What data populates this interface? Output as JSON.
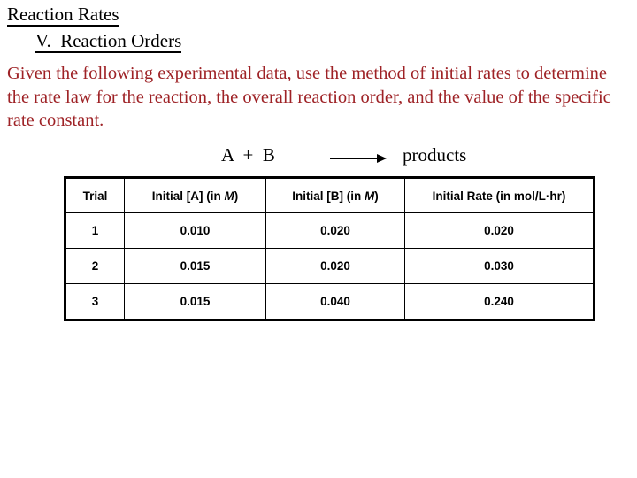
{
  "slide": {
    "title": "Reaction Rates",
    "subtitle": "V.  Reaction Orders",
    "body": "Given the following experimental data, use the method of initial rates to determine the rate law for the reaction, the overall reaction order, and the value of the specific rate constant.",
    "equation": {
      "reactants": "A  +  B",
      "arrow_icon": "right-arrow-icon",
      "products": "products"
    },
    "colors": {
      "body_text": "#9E2226",
      "title_text": "#000000",
      "table_border": "#000000",
      "background": "#FFFFFF"
    }
  },
  "table": {
    "headers": {
      "trial": "Trial",
      "a_prefix": "Initial [A] (in ",
      "a_unit": "M",
      "a_suffix": ")",
      "b_prefix": "Initial [B] (in ",
      "b_unit": "M",
      "b_suffix": ")",
      "rate": "Initial Rate (in mol/L·hr)"
    },
    "rows": [
      {
        "trial": "1",
        "a": "0.010",
        "b": "0.020",
        "rate": "0.020"
      },
      {
        "trial": "2",
        "a": "0.015",
        "b": "0.020",
        "rate": "0.030"
      },
      {
        "trial": "3",
        "a": "0.015",
        "b": "0.040",
        "rate": "0.240"
      }
    ]
  }
}
